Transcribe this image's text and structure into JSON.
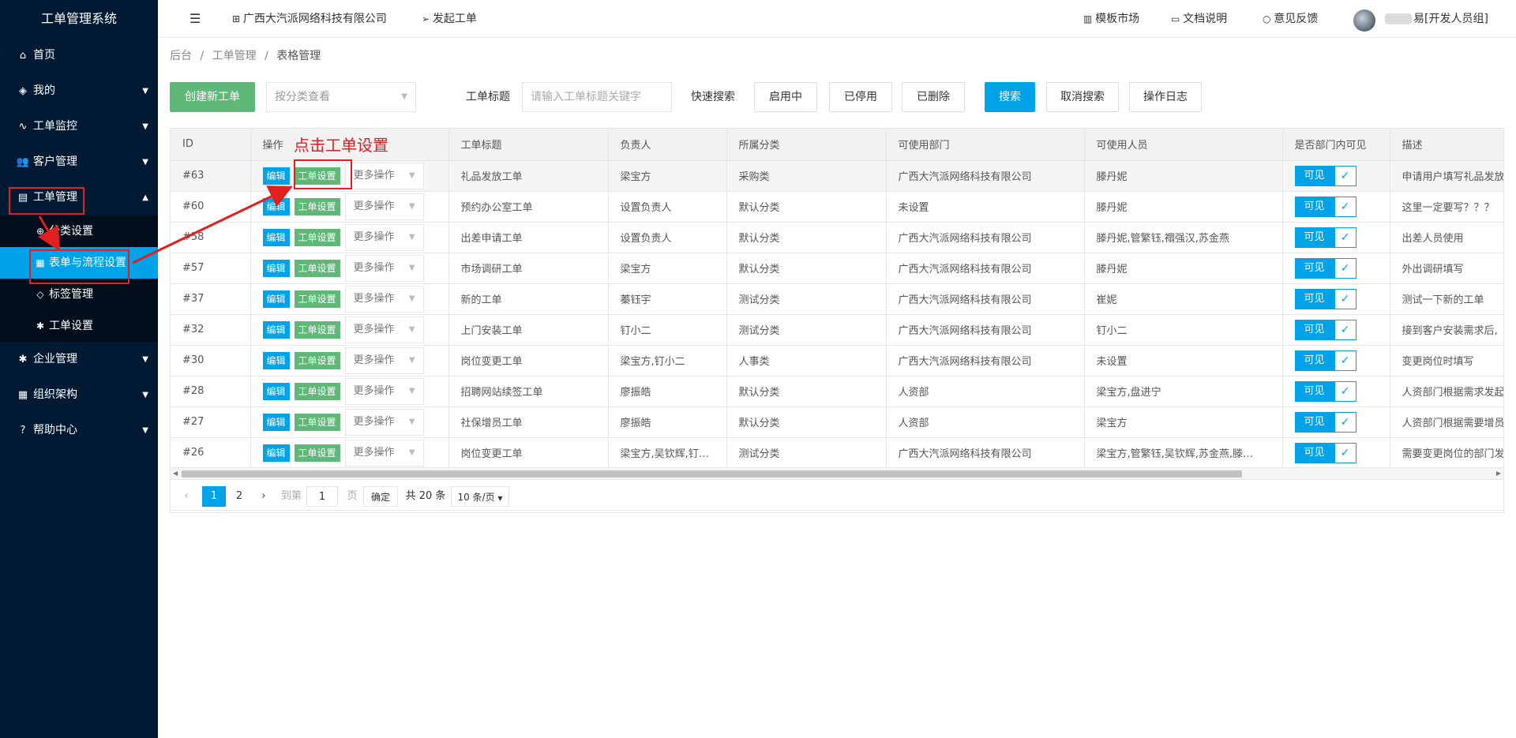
{
  "sidebar": {
    "brand": "工单管理系统",
    "items": [
      {
        "label": "首页",
        "icon": "home-icon",
        "glyph": "⌂",
        "caret": ""
      },
      {
        "label": "我的",
        "icon": "layers-icon",
        "glyph": "◈",
        "caret": "▼"
      },
      {
        "label": "工单监控",
        "icon": "pulse-icon",
        "glyph": "∿",
        "caret": "▼"
      },
      {
        "label": "客户管理",
        "icon": "users-icon",
        "glyph": "👥",
        "caret": "▼"
      },
      {
        "label": "工单管理",
        "icon": "clipboard-icon",
        "glyph": "▤",
        "caret": "▲"
      }
    ],
    "sub_items": [
      {
        "label": "分类设置",
        "icon": "target-icon",
        "glyph": "⊕"
      },
      {
        "label": "表单与流程设置",
        "icon": "table-icon",
        "glyph": "▦"
      },
      {
        "label": "标签管理",
        "icon": "tag-icon",
        "glyph": "◇"
      },
      {
        "label": "工单设置",
        "icon": "gear-icon",
        "glyph": "✱"
      }
    ],
    "items_after": [
      {
        "label": "企业管理",
        "icon": "gear-icon",
        "glyph": "✱",
        "caret": "▼"
      },
      {
        "label": "组织架构",
        "icon": "calendar-icon",
        "glyph": "▦",
        "caret": "▼"
      },
      {
        "label": "帮助中心",
        "icon": "question-icon",
        "glyph": "?",
        "caret": "▼"
      }
    ]
  },
  "topbar": {
    "menu_glyph": "☰",
    "company": "广西大汽派网络科技有限公司",
    "start_ticket": "发起工单",
    "template_market": "模板市场",
    "docs": "文档说明",
    "feedback": "意见反馈",
    "user_suffix": "[开发人员组]",
    "user_prefix_char": "易"
  },
  "breadcrumb": {
    "home": "后台",
    "sep": "/",
    "parent": "工单管理",
    "current": "表格管理"
  },
  "toolbar": {
    "create": "创建新工单",
    "category_placeholder": "按分类查看",
    "title_label": "工单标题",
    "title_placeholder": "请输入工单标题关键字",
    "quick_search": "快速搜索",
    "enabled": "启用中",
    "disabled": "已停用",
    "deleted": "已删除",
    "search": "搜索",
    "cancel_search": "取消搜索",
    "log": "操作日志"
  },
  "annotation": "点击工单设置",
  "table": {
    "columns": [
      "ID",
      "操作",
      "工单标题",
      "负责人",
      "所属分类",
      "可使用部门",
      "可使用人员",
      "是否部门内可见",
      "描述"
    ],
    "edit": "编辑",
    "settings": "工单设置",
    "more": "更多操作",
    "visible": "可见",
    "rows": [
      {
        "id": "#63",
        "title": "礼品发放工单",
        "owner": "梁宝方",
        "category": "采购类",
        "dept": "广西大汽派网络科技有限公司",
        "users": "滕丹妮",
        "desc": "申请用户填写礼品发放"
      },
      {
        "id": "#60",
        "title": "预约办公室工单",
        "owner": "设置负责人",
        "category": "默认分类",
        "dept": "未设置",
        "users": "滕丹妮",
        "desc": "这里一定要写？？？"
      },
      {
        "id": "#58",
        "title": "出差申请工单",
        "owner": "设置负责人",
        "category": "默认分类",
        "dept": "广西大汽派网络科技有限公司",
        "users": "滕丹妮,管繁钰,禤强汉,苏金燕",
        "desc": "出差人员使用"
      },
      {
        "id": "#57",
        "title": "市场调研工单",
        "owner": "梁宝方",
        "category": "默认分类",
        "dept": "广西大汽派网络科技有限公司",
        "users": "滕丹妮",
        "desc": "外出调研填写"
      },
      {
        "id": "#37",
        "title": "新的工单",
        "owner": "蓁钰宇",
        "category": "测试分类",
        "dept": "广西大汽派网络科技有限公司",
        "users": "崔妮",
        "desc": "测试一下新的工单"
      },
      {
        "id": "#32",
        "title": "上门安装工单",
        "owner": "钉小二",
        "category": "测试分类",
        "dept": "广西大汽派网络科技有限公司",
        "users": "钉小二",
        "desc": "接到客户安装需求后,"
      },
      {
        "id": "#30",
        "title": "岗位变更工单",
        "owner": "梁宝方,钉小二",
        "category": "人事类",
        "dept": "广西大汽派网络科技有限公司",
        "users": "未设置",
        "desc": "变更岗位时填写"
      },
      {
        "id": "#28",
        "title": "招聘网站续签工单",
        "owner": "廖振皓",
        "category": "默认分类",
        "dept": "人资部",
        "users": "梁宝方,盘进宁",
        "desc": "人资部门根据需求发起"
      },
      {
        "id": "#27",
        "title": "社保增员工单",
        "owner": "廖振皓",
        "category": "默认分类",
        "dept": "人资部",
        "users": "梁宝方",
        "desc": "人资部门根据需要增员"
      },
      {
        "id": "#26",
        "title": "岗位变更工单",
        "owner": "梁宝方,吴钦辉,钉…",
        "category": "测试分类",
        "dept": "广西大汽派网络科技有限公司",
        "users": "梁宝方,管繁钰,吴钦辉,苏金燕,滕…",
        "desc": "需要变更岗位的部门发"
      }
    ]
  },
  "pager": {
    "page1": "1",
    "page2": "2",
    "goto": "到第",
    "goto_value": "1",
    "page_unit": "页",
    "confirm": "确定",
    "total": "共 20 条",
    "per_page": "10 条/页"
  }
}
